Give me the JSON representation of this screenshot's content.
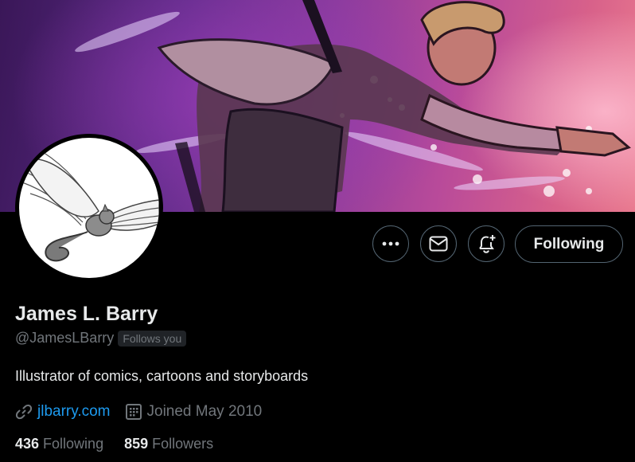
{
  "profile": {
    "name": "James L. Barry",
    "handle": "@JamesLBarry",
    "follows_you": "Follows you",
    "bio": "Illustrator of comics, cartoons and storyboards",
    "website": "jlbarry.com",
    "joined": "Joined May 2010",
    "following_count": "436",
    "following_label": "Following",
    "followers_count": "859",
    "followers_label": "Followers"
  },
  "actions": {
    "more_icon": "more-horizontal-icon",
    "message_icon": "envelope-icon",
    "notify_icon": "bell-plus-icon",
    "follow_button_label": "Following"
  },
  "icons": {
    "website": "link-icon",
    "joined": "calendar-icon"
  },
  "colors": {
    "background": "#000000",
    "primary_text": "#e7e9ea",
    "secondary_text": "#71767b",
    "link": "#1d9bf0",
    "button_border": "#536471"
  }
}
